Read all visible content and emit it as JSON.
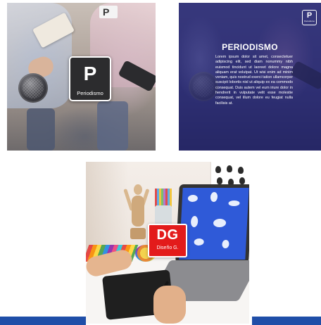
{
  "cards": {
    "periodismo_photo": {
      "badge_glyph": "P",
      "badge_caption": "Periodismo",
      "lanyard_glyph": "P"
    },
    "periodismo_info": {
      "logo_glyph": "P",
      "logo_caption": "Periodismo",
      "title": "PERIODISMO",
      "body": "Lorem ipsum dolor sit amet, consectetuer adipiscing elit, sed diam nonummy nibh euismod tincidunt ut laoreet dolore magna aliquam erat volutpat. Ut wisi enim ad minim veniam, quis nostrud exerci tation ullamcorper suscipit lobortis nisl ut aliquip ex ea commodo consequat. Duis autem vel eum iriure dolor in hendrerit in vulputate velit esse molestie consequat, vel illum dolore eu feugiat nulla facilisis at."
    },
    "diseno_grafico": {
      "badge_glyph": "DG",
      "badge_caption": "Diseño G."
    }
  },
  "colors": {
    "accent_blue": "#1f4ea8",
    "dg_red": "#e31b1b",
    "periodismo_dark": "#2c2c2e",
    "overlay_indigo": "#3a3a7d"
  }
}
